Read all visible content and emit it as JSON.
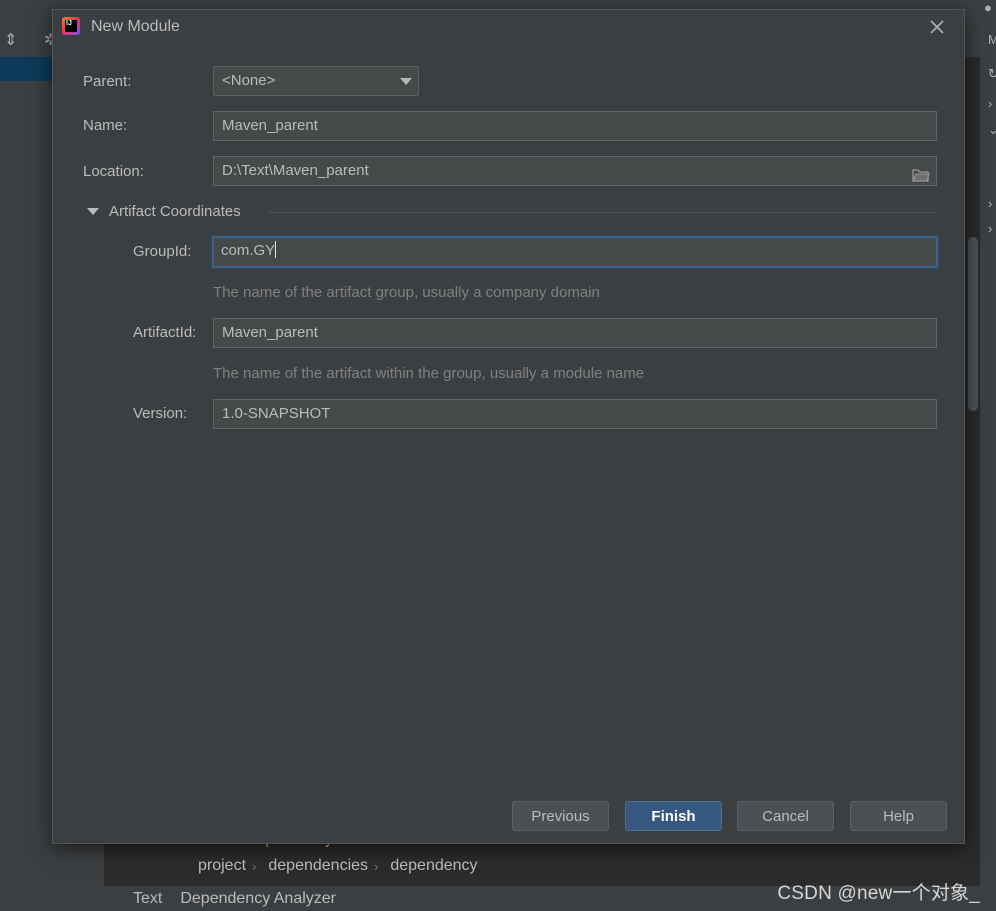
{
  "dialog": {
    "title": "New Module",
    "logo_text": "IJ",
    "parent_label": "Parent:",
    "parent_value": "<None>",
    "name_label": "Name:",
    "name_value": "Maven_parent",
    "location_label": "Location:",
    "location_value": "D:\\Text\\Maven_parent",
    "section_title": "Artifact Coordinates",
    "groupid_label": "GroupId:",
    "groupid_value": "com.GY",
    "groupid_hint": "The name of the artifact group, usually a company domain",
    "artifactid_label": "ArtifactId:",
    "artifactid_value": "Maven_parent",
    "artifactid_hint": "The name of the artifact within the group, usually a module name",
    "version_label": "Version:",
    "version_value": "1.0-SNAPSHOT",
    "buttons": {
      "previous": "Previous",
      "finish": "Finish",
      "cancel": "Cancel",
      "help": "Help"
    }
  },
  "ide": {
    "breadcrumb": [
      "project",
      "dependencies",
      "dependency"
    ],
    "bottom_tabs": [
      "Text",
      "Dependency Analyzer"
    ],
    "code_peek": "<dependency>",
    "right_strip_glyph": "M"
  },
  "watermark": "CSDN @new一个对象_",
  "colors": {
    "dialog_bg": "#3c3f41",
    "field_bg": "#45494a",
    "focus_border": "#3d6185",
    "primary_button": "#365880",
    "hint_text": "#808080"
  }
}
